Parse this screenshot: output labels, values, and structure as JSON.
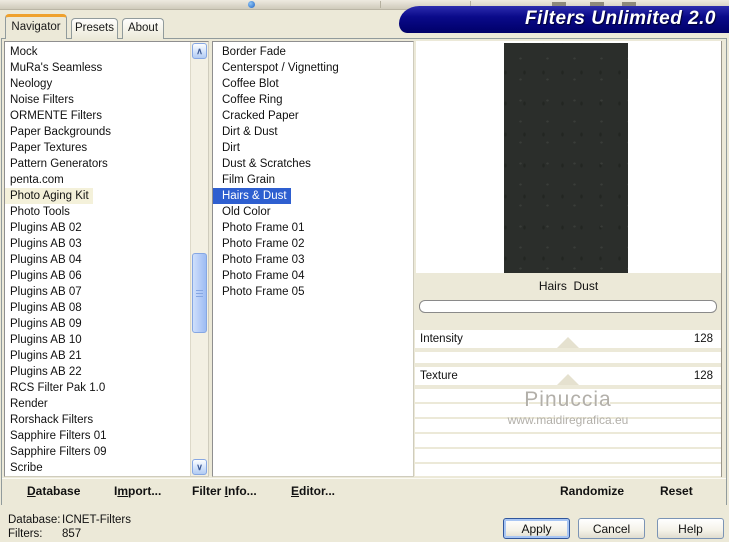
{
  "banner": {
    "title": "Filters Unlimited 2.0"
  },
  "tabs": {
    "navigator": "Navigator",
    "presets": "Presets",
    "about": "About"
  },
  "left_list": {
    "items": [
      "Mock",
      "MuRa's Seamless",
      "Neology",
      "Noise Filters",
      "ORMENTE Filters",
      "Paper Backgrounds",
      "Paper Textures",
      "Pattern Generators",
      "penta.com",
      "Photo Aging Kit",
      "Photo Tools",
      "Plugins AB 02",
      "Plugins AB 03",
      "Plugins AB 04",
      "Plugins AB 06",
      "Plugins AB 07",
      "Plugins AB 08",
      "Plugins AB 09",
      "Plugins AB 10",
      "Plugins AB 21",
      "Plugins AB 22",
      "RCS Filter Pak 1.0",
      "Render",
      "Rorshack Filters",
      "Sapphire Filters 01",
      "Sapphire Filters 09",
      "Scribe"
    ],
    "highlighted_item": "Photo Aging Kit"
  },
  "filter_list": {
    "items": [
      "Border Fade",
      "Centerspot / Vignetting",
      "Coffee Blot",
      "Coffee Ring",
      "Cracked Paper",
      "Dirt & Dust",
      "Dirt",
      "Dust & Scratches",
      "Film Grain",
      "Hairs & Dust",
      "Old Color",
      "Photo Frame 01",
      "Photo Frame 02",
      "Photo Frame 03",
      "Photo Frame 04",
      "Photo Frame 05"
    ],
    "selected_item": "Hairs & Dust"
  },
  "preview": {
    "caption": "Hairs  Dust"
  },
  "sliders": {
    "intensity_label": "Intensity",
    "intensity_value": "128",
    "texture_label": "Texture",
    "texture_value": "128"
  },
  "watermark": {
    "line1": "Pinuccia",
    "line2": "www.maidiregrafica.eu"
  },
  "toolbar": {
    "database": {
      "pre": "",
      "mn": "D",
      "post": "atabase"
    },
    "import": {
      "pre": "I",
      "mn": "m",
      "post": "port..."
    },
    "filter_info": {
      "pre": "Filter ",
      "mn": "I",
      "post": "nfo..."
    },
    "editor": {
      "pre": "",
      "mn": "E",
      "post": "ditor..."
    },
    "randomize": "Randomize",
    "reset": "Reset"
  },
  "status": {
    "database_label": "Database:",
    "database_value": "ICNET-Filters",
    "filters_label": "Filters:",
    "filters_value": "857"
  },
  "action_buttons": {
    "apply": "Apply",
    "cancel": "Cancel",
    "help": "Help"
  },
  "icons": {
    "scroll_up": "∧",
    "scroll_down": "∨"
  },
  "colors": {
    "dialog_bg": "#ece9d8",
    "selection_blue": "#2e5fd0",
    "highlight_row": "#f4f1da",
    "banner_navy": "#0a0a8a",
    "active_tab_accent": "#efa12d",
    "preview_dark": "#2b2e2b"
  }
}
